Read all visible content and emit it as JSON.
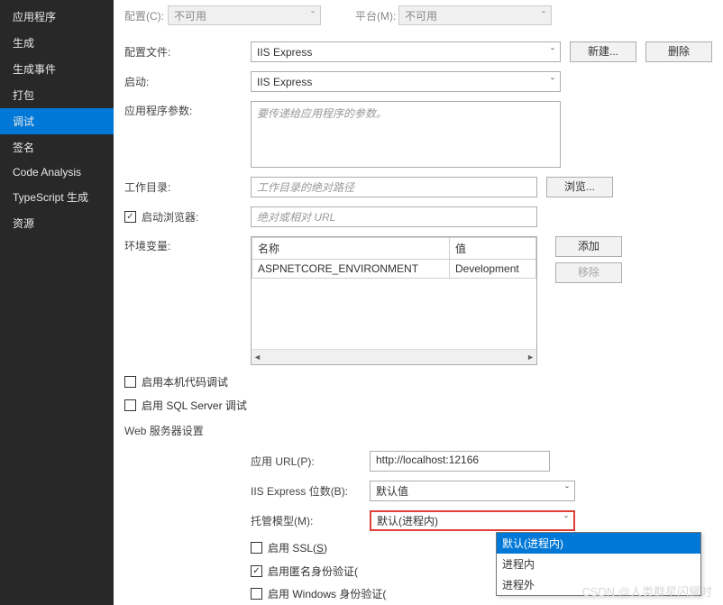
{
  "sidebar": {
    "items": [
      {
        "label": "应用程序"
      },
      {
        "label": "生成"
      },
      {
        "label": "生成事件"
      },
      {
        "label": "打包"
      },
      {
        "label": "调试"
      },
      {
        "label": "签名"
      },
      {
        "label": "Code Analysis"
      },
      {
        "label": "TypeScript 生成"
      },
      {
        "label": "资源"
      }
    ],
    "active_index": 4
  },
  "top": {
    "config_label": "配置(C):",
    "config_value": "不可用",
    "platform_label": "平台(M):",
    "platform_value": "不可用"
  },
  "form": {
    "profile_label": "配置文件:",
    "profile_value": "IIS Express",
    "new_btn": "新建...",
    "delete_btn": "删除",
    "launch_label": "启动:",
    "launch_value": "IIS Express",
    "args_label": "应用程序参数:",
    "args_placeholder": "要传递给应用程序的参数。",
    "workdir_label": "工作目录:",
    "workdir_placeholder": "工作目录的绝对路径",
    "browse_btn": "浏览...",
    "launch_browser_label": "启动浏览器:",
    "launch_browser_checked": true,
    "browser_url_placeholder": "绝对或相对 URL",
    "env_label": "环境变量:",
    "env_cols": {
      "name": "名称",
      "value": "值"
    },
    "env_row": {
      "name": "ASPNETCORE_ENVIRONMENT",
      "value": "Development"
    },
    "add_btn": "添加",
    "remove_btn": "移除",
    "native_debug_label": "启用本机代码调试",
    "sql_debug_label": "启用 SQL Server 调试"
  },
  "web": {
    "section_title": "Web 服务器设置",
    "app_url_label": "应用 URL(P):",
    "app_url_value": "http://localhost:12166",
    "iis_bitness_label": "IIS Express 位数(B):",
    "iis_bitness_value": "默认值",
    "hosting_label": "托管模型(M):",
    "hosting_value": "默认(进程内)",
    "hosting_options": [
      "默认(进程内)",
      "进程内",
      "进程外"
    ],
    "enable_ssl_label_pre": "启用 SSL(",
    "enable_ssl_label_u": "S",
    "enable_ssl_label_post": ")",
    "anon_auth_label": "启用匿名身份验证(",
    "win_auth_label": "启用 Windows 身份验证("
  },
  "watermark": "CSDN @人类群星闪耀时"
}
